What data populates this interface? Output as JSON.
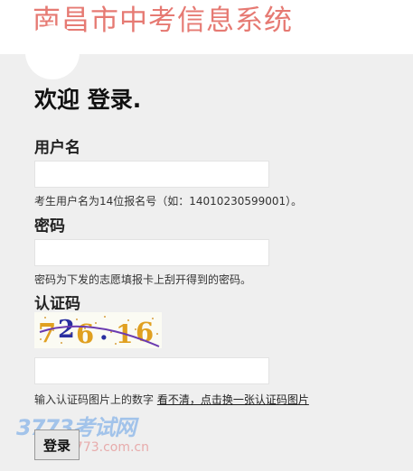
{
  "header": {
    "system_title": "南昌市中考信息系统"
  },
  "form": {
    "welcome": "欢迎 登录.",
    "username": {
      "label": "用户名",
      "value": "",
      "hint": "考生用户名为14位报名号（如：14010230599001）。"
    },
    "password": {
      "label": "密码",
      "value": "",
      "hint": "密码为下发的志愿填报卡上刮开得到的密码。"
    },
    "captcha": {
      "label": "认证码",
      "image_text": "726.16",
      "value": "",
      "hint_prefix": "输入认证码图片上的数字",
      "refresh_link": "看不清，点击换一张认证码图片"
    },
    "submit_label": "登录"
  },
  "watermark": {
    "brand": "3773考试网",
    "url": "3773.com.cn"
  },
  "colors": {
    "brand_title": "#e67a73",
    "background": "#efefef"
  }
}
